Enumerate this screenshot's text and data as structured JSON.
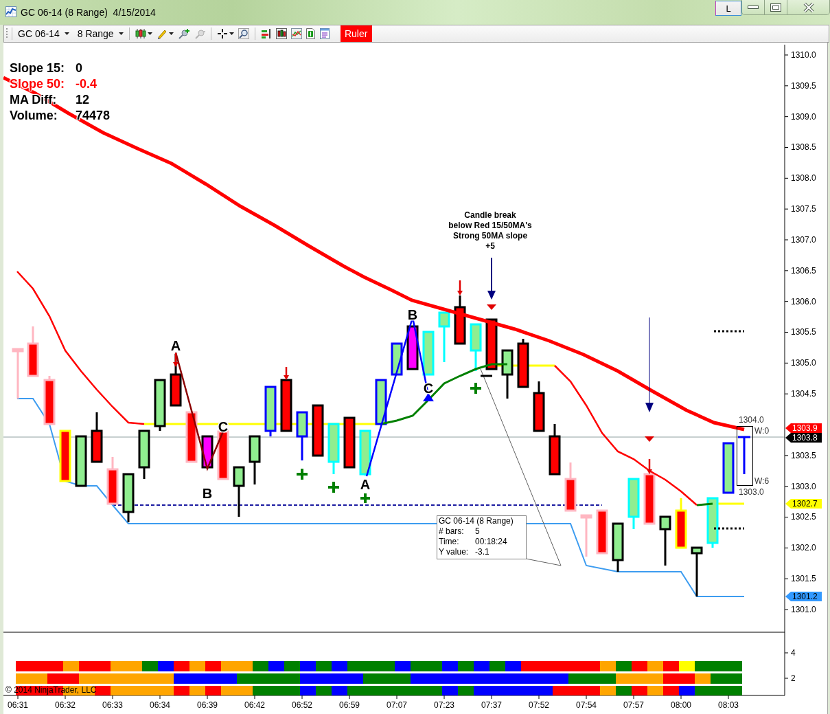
{
  "window": {
    "title": "GC 06-14 (8 Range)  4/15/2014",
    "buttons": [
      "L"
    ]
  },
  "toolbar": {
    "instrument": "GC 06-14",
    "period": "8 Range",
    "ruler": {
      "label": "Ruler",
      "active": true
    }
  },
  "stats": [
    {
      "label": "Slope 15:",
      "value": "0",
      "color": "#000000"
    },
    {
      "label": "Slope 50:",
      "value": "-0.4",
      "color": "#ff0000"
    },
    {
      "label": "MA Diff:",
      "value": "12",
      "color": "#000000"
    },
    {
      "label": "Volume:",
      "value": "74478",
      "color": "#000000"
    }
  ],
  "annotation": {
    "lines": [
      "Candle break",
      "below Red 15/50MA's",
      "Strong 50MA slope",
      "+5"
    ]
  },
  "pattern_labels": [
    "A",
    "B",
    "C",
    "A",
    "B",
    "C"
  ],
  "current_bar": {
    "high": "1304.0",
    "low": "1303.0",
    "top_count": "W:0",
    "bottom_count": "W:6"
  },
  "tooltip": {
    "title": "GC 06-14 (8 Range)",
    "rows": [
      {
        "label": "# bars:",
        "value": "5"
      },
      {
        "label": "Time:",
        "value": "00:18:24"
      },
      {
        "label": "Y value:",
        "value": "-3.1"
      }
    ]
  },
  "price_axis": {
    "ticks": [
      "1310.0",
      "1309.5",
      "1309.0",
      "1308.5",
      "1308.0",
      "1307.5",
      "1307.0",
      "1306.5",
      "1306.0",
      "1305.5",
      "1305.0",
      "1304.5",
      "1303.5",
      "1303.0",
      "1302.5",
      "1302.0",
      "1301.5",
      "1301.0"
    ],
    "tags": [
      {
        "text": "1303.9",
        "color": "#ff0000"
      },
      {
        "text": "1303.8",
        "color": "#000000"
      },
      {
        "text": "1302.7",
        "color": "#ffff00"
      },
      {
        "text": "1301.2",
        "color": "#3399ff"
      }
    ]
  },
  "indicator_axis": {
    "ticks": [
      "4",
      "2"
    ]
  },
  "time_axis": {
    "labels": [
      "06:31",
      "06:32",
      "06:33",
      "06:34",
      "06:39",
      "06:42",
      "06:52",
      "06:59",
      "07:07",
      "07:23",
      "07:37",
      "07:52",
      "07:54",
      "07:57",
      "08:00",
      "08:03"
    ]
  },
  "copyright": "© 2014 NinjaTrader, LLC"
}
